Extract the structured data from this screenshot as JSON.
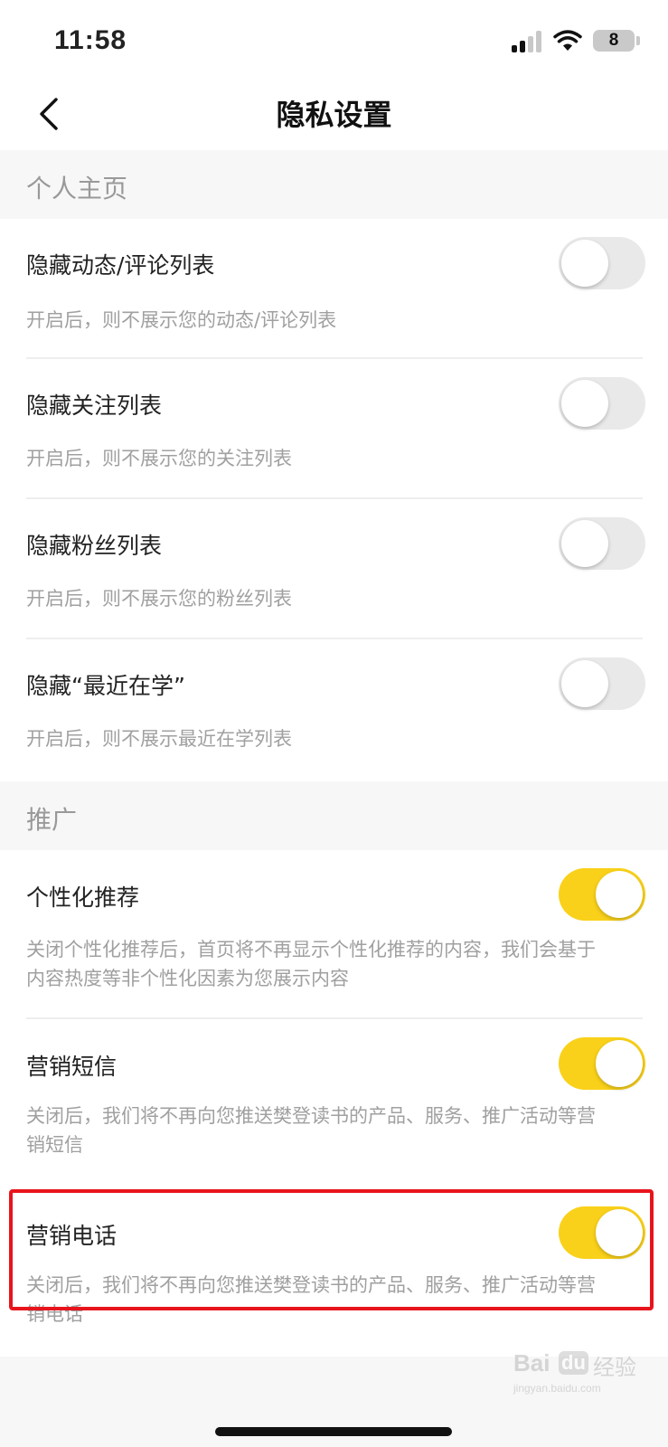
{
  "status_bar": {
    "time": "11:58",
    "battery_level": "8",
    "icons": [
      "signal-icon",
      "wifi-icon",
      "battery-icon"
    ]
  },
  "nav": {
    "title": "隐私设置",
    "back_icon": "chevron-left-icon"
  },
  "sections": [
    {
      "header": "个人主页",
      "items": [
        {
          "title": "隐藏动态/评论列表",
          "desc": "开启后，则不展示您的动态/评论列表",
          "on": false
        },
        {
          "title": "隐藏关注列表",
          "desc": "开启后，则不展示您的关注列表",
          "on": false
        },
        {
          "title": "隐藏粉丝列表",
          "desc": "开启后，则不展示您的粉丝列表",
          "on": false
        },
        {
          "title": "隐藏“最近在学”",
          "desc": "开启后，则不展示最近在学列表",
          "on": false
        }
      ]
    },
    {
      "header": "推广",
      "items": [
        {
          "title": "个性化推荐",
          "desc_lines": [
            "关闭个性化推荐后，首页将不再显示个性化推荐的内容，我们会基于",
            "内容热度等非个性化因素为您展示内容"
          ],
          "on": true
        },
        {
          "title": "营销短信",
          "desc_lines": [
            "关闭后，我们将不再向您推送樊登读书的产品、服务、推广活动等营",
            "销短信"
          ],
          "on": true
        },
        {
          "title": "营销电话",
          "desc_lines": [
            "关闭后，我们将不再向您推送樊登读书的产品、服务、推广活动等营",
            "销电话"
          ],
          "on": true
        }
      ]
    }
  ],
  "colors": {
    "toggle_on": "#f9d11a",
    "toggle_off": "#e9e9ea",
    "highlight_border": "#e8141c",
    "background": "#f7f7f7"
  },
  "watermark": {
    "brand": "Bai",
    "brand_suffix": "du",
    "jy": "经验",
    "url": "jingyan.baidu.com"
  }
}
